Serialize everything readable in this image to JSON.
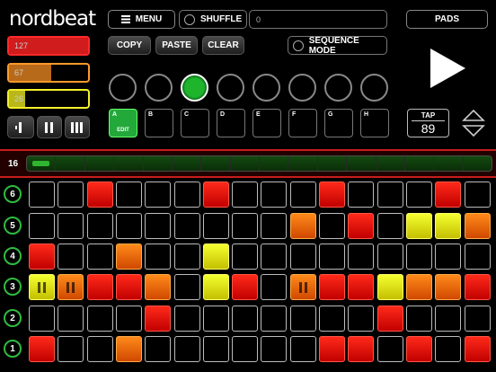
{
  "app": {
    "logo": "nordbeat"
  },
  "levels": [
    {
      "value": "127",
      "fraction": 1.0,
      "color": "#d01c1c"
    },
    {
      "value": "67",
      "fraction": 0.53,
      "color": "#b86a1b"
    },
    {
      "value": "26",
      "fraction": 0.2,
      "color": "#b9b719"
    }
  ],
  "toolbar": {
    "menu_label": "MENU",
    "shuffle_label": "SHUFFLE",
    "shuffle_value": "0",
    "pads_label": "PADS",
    "copy_label": "COPY",
    "paste_label": "PASTE",
    "clear_label": "CLEAR",
    "sequence_mode_label": "SEQUENCE MODE"
  },
  "patterns": {
    "selected_index": 2,
    "slots": [
      "A",
      "B",
      "C",
      "D",
      "E",
      "F",
      "G",
      "H"
    ],
    "edit_label": "EDIT"
  },
  "tempo": {
    "tap_label": "TAP",
    "bpm": "89"
  },
  "steps": {
    "count_label": "16"
  },
  "tracks": [
    {
      "label": "6",
      "steps": [
        "off",
        "off",
        "red",
        "off",
        "off",
        "off",
        "red",
        "off",
        "off",
        "off",
        "red",
        "off",
        "off",
        "off",
        "red",
        "off"
      ]
    },
    {
      "label": "5",
      "steps": [
        "off",
        "off",
        "off",
        "off",
        "off",
        "off",
        "off",
        "off",
        "off",
        "orange",
        "off",
        "red",
        "off",
        "yellow",
        "yellow",
        "orange"
      ]
    },
    {
      "label": "4",
      "steps": [
        "red",
        "off",
        "off",
        "orange",
        "off",
        "off",
        "yellow",
        "off",
        "off",
        "off",
        "off",
        "off",
        "off",
        "off",
        "off",
        "off"
      ]
    },
    {
      "label": "3",
      "steps": [
        "yellow-p",
        "orange-p",
        "red",
        "red",
        "orange",
        "off",
        "yellow",
        "red",
        "off",
        "orange-p",
        "red",
        "red",
        "yellow",
        "orange",
        "orange",
        "red"
      ]
    },
    {
      "label": "2",
      "steps": [
        "off",
        "off",
        "off",
        "off",
        "red",
        "off",
        "off",
        "off",
        "off",
        "off",
        "off",
        "off",
        "red",
        "off",
        "off",
        "off"
      ]
    },
    {
      "label": "1",
      "steps": [
        "red",
        "off",
        "off",
        "orange",
        "off",
        "off",
        "off",
        "off",
        "off",
        "off",
        "red",
        "red",
        "off",
        "red",
        "off",
        "red"
      ]
    }
  ]
}
